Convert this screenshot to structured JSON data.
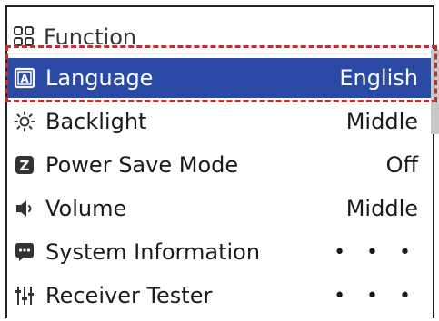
{
  "header": {
    "title": "Function",
    "icon": "grid-icon"
  },
  "menu": {
    "items": [
      {
        "label": "Language",
        "value": "English",
        "icon": "language-icon",
        "selected": true
      },
      {
        "label": "Backlight",
        "value": "Middle",
        "icon": "sun-icon",
        "selected": false
      },
      {
        "label": "Power Save Mode",
        "value": "Off",
        "icon": "power-save-icon",
        "selected": false
      },
      {
        "label": "Volume",
        "value": "Middle",
        "icon": "speaker-icon",
        "selected": false
      },
      {
        "label": "System Information",
        "value": "• • •",
        "icon": "chat-bubble-icon",
        "selected": false
      },
      {
        "label": "Receiver Tester",
        "value": "• • •",
        "icon": "sliders-icon",
        "selected": false
      }
    ]
  },
  "colors": {
    "selection": "#2a4aa6",
    "highlight_outline": "#c0302a"
  }
}
